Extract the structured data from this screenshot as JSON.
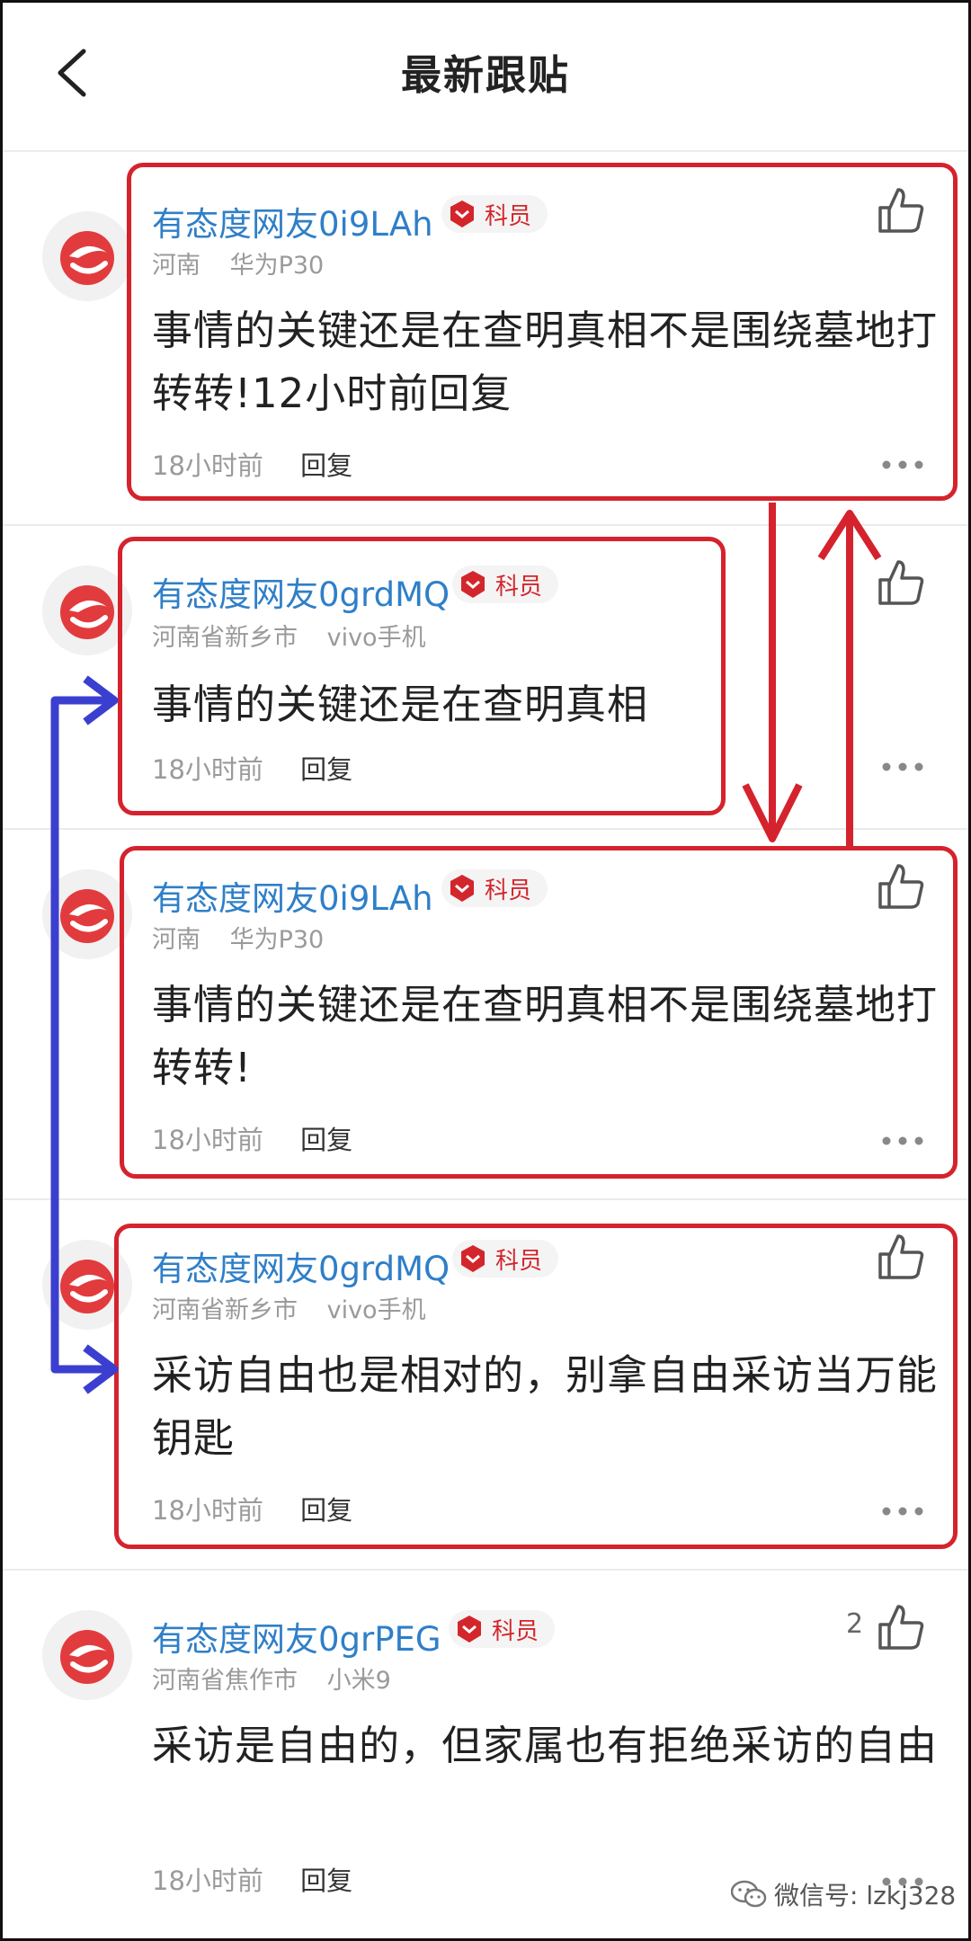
{
  "header": {
    "title": "最新跟贴"
  },
  "comments": [
    {
      "username": "有态度网友0i9LAh",
      "badge": "科员",
      "location": "河南",
      "device": "华为P30",
      "content": "事情的关键还是在查明真相不是围绕墓地打转转!12小时前回复",
      "time": "18小时前",
      "reply": "回复",
      "likes": ""
    },
    {
      "username": "有态度网友0grdMQ",
      "badge": "科员",
      "location": "河南省新乡市",
      "device": "vivo手机",
      "content": "事情的关键还是在查明真相",
      "time": "18小时前",
      "reply": "回复",
      "likes": ""
    },
    {
      "username": "有态度网友0i9LAh",
      "badge": "科员",
      "location": "河南",
      "device": "华为P30",
      "content": "事情的关键还是在查明真相不是围绕墓地打转转!",
      "time": "18小时前",
      "reply": "回复",
      "likes": ""
    },
    {
      "username": "有态度网友0grdMQ",
      "badge": "科员",
      "location": "河南省新乡市",
      "device": "vivo手机",
      "content": "采访自由也是相对的，别拿自由采访当万能钥匙",
      "time": "18小时前",
      "reply": "回复",
      "likes": ""
    },
    {
      "username": "有态度网友0grPEG",
      "badge": "科员",
      "location": "河南省焦作市",
      "device": "小米9",
      "content": "采访是自由的，但家属也有拒绝采访的自由",
      "time": "18小时前",
      "reply": "回复",
      "likes": "2"
    }
  ],
  "watermark": {
    "text": "微信号: lzkj328"
  },
  "colors": {
    "username": "#2f7fc8",
    "badge": "#d3262c",
    "highlight": "#d5232d",
    "arrow_blue": "#3b3fd0"
  },
  "icons": {
    "back": "chevron-left-icon",
    "like": "thumbs-up-icon",
    "more": "more-dots-icon",
    "avatar": "netease-logo-icon",
    "badge": "shield-badge-icon"
  }
}
